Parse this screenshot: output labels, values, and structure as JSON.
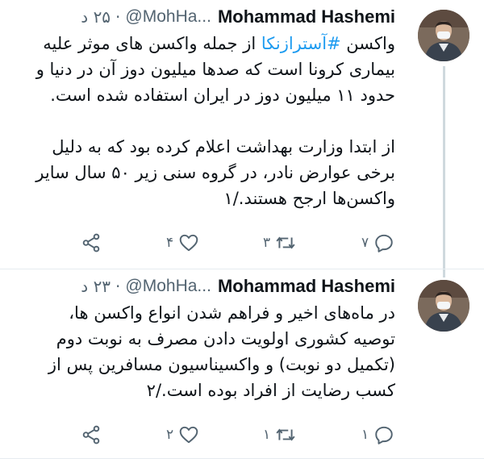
{
  "tweets": [
    {
      "name": "Mohammad Hashemi",
      "handle": "@MohHa...",
      "time": "۲۵ د",
      "paragraphs": [
        {
          "before": "واکسن ",
          "hashtag": "#آسترازنکا",
          "after": " از جمله واکسن های موثر علیه بیماری کرونا است که صدها میلیون دوز آن در دنیا و حدود ۱۱ میلیون دوز در ایران استفاده شده است."
        },
        {
          "before": "از ابتدا وزارت بهداشت اعلام کرده بود که به دلیل برخی عوارض نادر، در گروه سنی زیر ۵۰ سال سایر واکسن‌ها ارجح هستند./۱",
          "hashtag": "",
          "after": ""
        }
      ],
      "reply_count": "۷",
      "retweet_count": "۳",
      "like_count": "۴"
    },
    {
      "name": "Mohammad Hashemi",
      "handle": "@MohHa...",
      "time": "۲۳ د",
      "paragraphs": [
        {
          "before": "در ماه‌های اخیر و فراهم شدن انواع واکسن ها، توصیه کشوری اولویت دادن مصرف به نوبت دوم (تکمیل دو نوبت) و واکسیناسیون مسافرین پس از کسب رضایت از افراد بوده است./۲",
          "hashtag": "",
          "after": ""
        }
      ],
      "reply_count": "۱",
      "retweet_count": "۱",
      "like_count": "۲"
    }
  ],
  "icons": {
    "reply": "reply-icon",
    "retweet": "retweet-icon",
    "like": "heart-icon",
    "share": "share-icon"
  },
  "colors": {
    "link": "#1d9bf0",
    "secondary_text": "#536471",
    "thread_line": "#cfd9de"
  }
}
